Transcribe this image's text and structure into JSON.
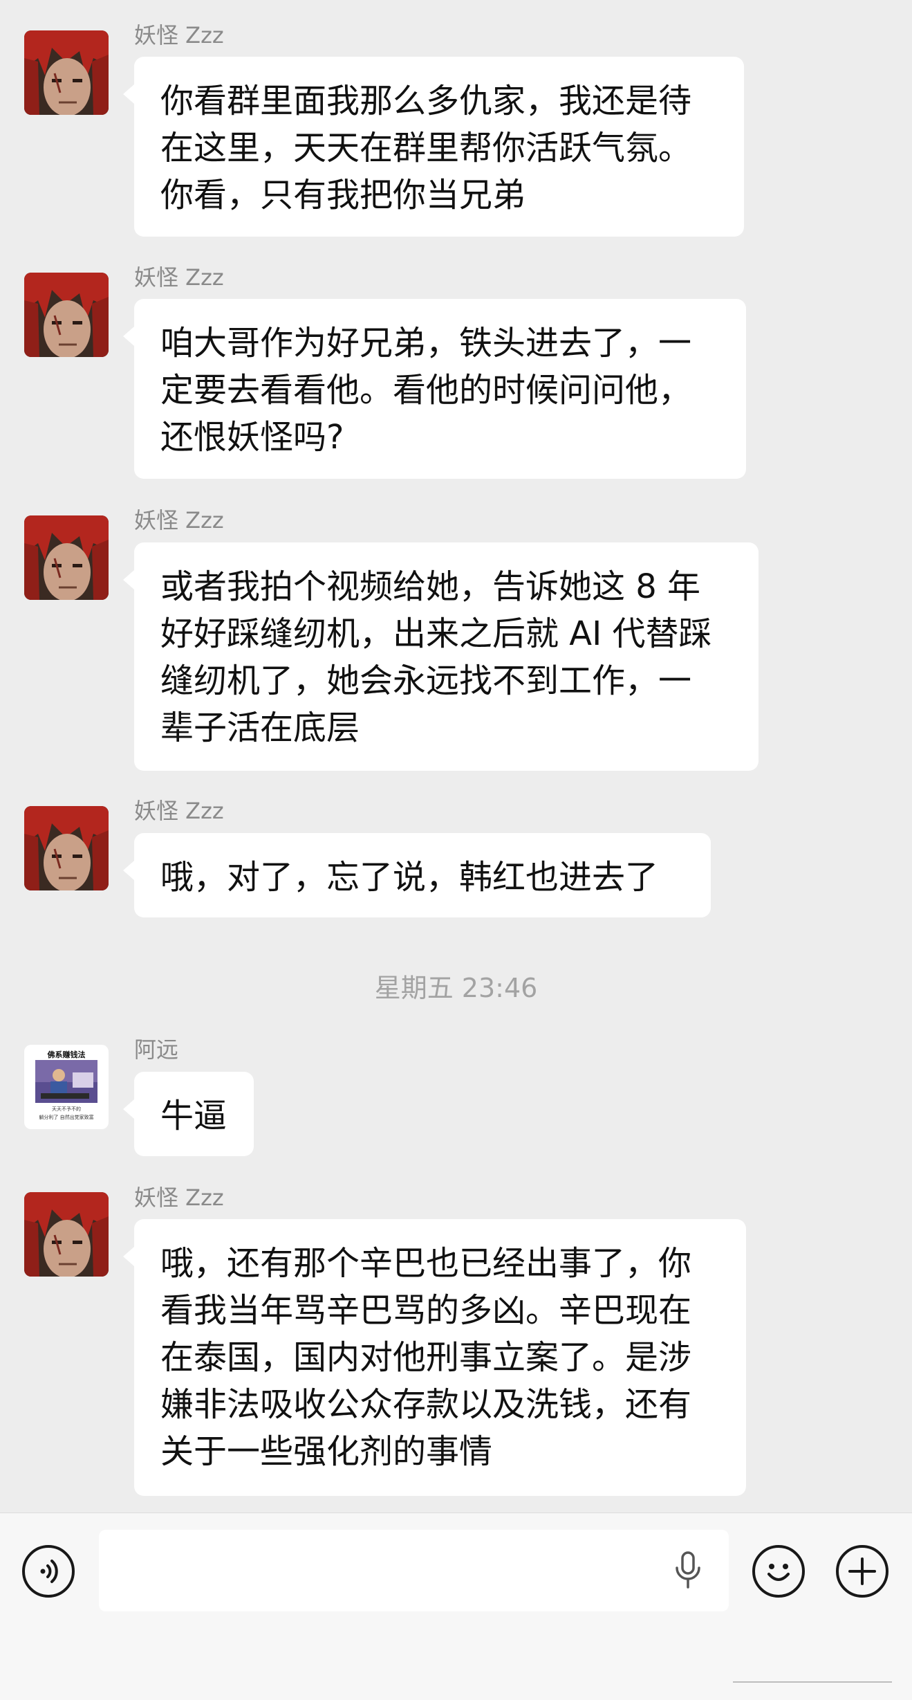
{
  "chat": {
    "messages": [
      {
        "sender": "妖怪 Zzz",
        "avatar": "red-haired-man-avatar",
        "text": "你看群里面我那么多仇家，我还是待\n在这里，天天在群里帮你活跃气氛。\n你看，只有我把你当兄弟"
      },
      {
        "sender": "妖怪 Zzz",
        "avatar": "red-haired-man-avatar",
        "text": "咱大哥作为好兄弟，铁头进去了，一\n定要去看看他。看他的时候问问他，\n还恨妖怪吗?"
      },
      {
        "sender": "妖怪 Zzz",
        "avatar": "red-haired-man-avatar",
        "text": "或者我拍个视频给她，告诉她这 8 年\n好好踩缝纫机，出来之后就 AI 代替踩\n缝纫机了，她会永远找不到工作，一\n辈子活在底层"
      },
      {
        "sender": "妖怪 Zzz",
        "avatar": "red-haired-man-avatar",
        "text": "哦，对了，忘了说，韩红也进去了"
      },
      {
        "sender": "阿远",
        "avatar": "meme-avatar",
        "text": "牛逼"
      },
      {
        "sender": "妖怪 Zzz",
        "avatar": "red-haired-man-avatar",
        "text": "哦，还有那个辛巴也已经出事了，你\n看我当年骂辛巴骂的多凶。辛巴现在\n在泰国，国内对他刑事立案了。是涉\n嫌非法吸收公众存款以及洗钱，还有\n关于一些强化剂的事情"
      }
    ],
    "timestamp": "星期五 23:46",
    "meme_avatar": {
      "title": "佛系赚钱法",
      "caption_1": "天天不予不的",
      "caption_2": "躺分利了 自然出党家致富"
    }
  },
  "input_bar": {
    "voice_icon": "voice-mode-icon",
    "mic_icon": "microphone-icon",
    "emoji_icon": "emoji-icon",
    "plus_icon": "plus-icon",
    "input_value": ""
  }
}
